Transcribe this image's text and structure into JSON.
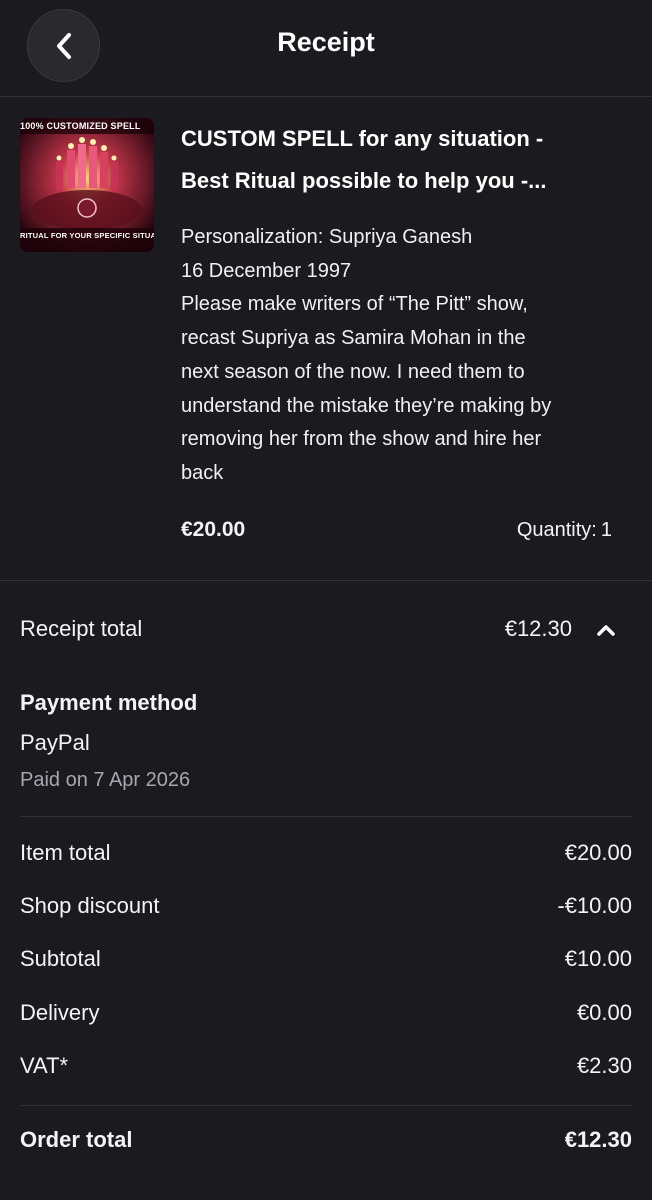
{
  "header": {
    "title": "Receipt"
  },
  "item": {
    "image_caption_top": "100% CUSTOMIZED SPELL",
    "image_caption_bottom": "RITUAL FOR YOUR SPECIFIC SITUATION",
    "title_line1": "CUSTOM SPELL for any situation -",
    "title_line2": "Best Ritual possible to help you -...",
    "personalization": [
      "Personalization: Supriya Ganesh",
      "16 December 1997",
      "Please make writers of “The Pitt” show,",
      "recast Supriya as Samira Mohan in the",
      "next season of the now. I need them to",
      "understand the mistake they’re making by",
      "removing her from the show and hire her",
      "back"
    ],
    "price": "€20.00",
    "quantity_label": "Quantity:",
    "quantity_value": "1"
  },
  "receipt_total": {
    "label": "Receipt total",
    "value": "€12.30"
  },
  "payment": {
    "title": "Payment method",
    "method": "PayPal",
    "paid_on": "Paid on 7 Apr 2026"
  },
  "breakdown": [
    {
      "label": "Item total",
      "value": "€20.00"
    },
    {
      "label": "Shop discount",
      "value": "-€10.00"
    },
    {
      "label": "Subtotal",
      "value": "€10.00"
    },
    {
      "label": "Delivery",
      "value": "€0.00"
    },
    {
      "label": "VAT*",
      "value": "€2.30"
    }
  ],
  "order_total": {
    "label": "Order total",
    "value": "€12.30"
  },
  "colors": {
    "background": "#1b1a1f",
    "divider": "#323137",
    "muted_text": "#a8a7ad"
  }
}
